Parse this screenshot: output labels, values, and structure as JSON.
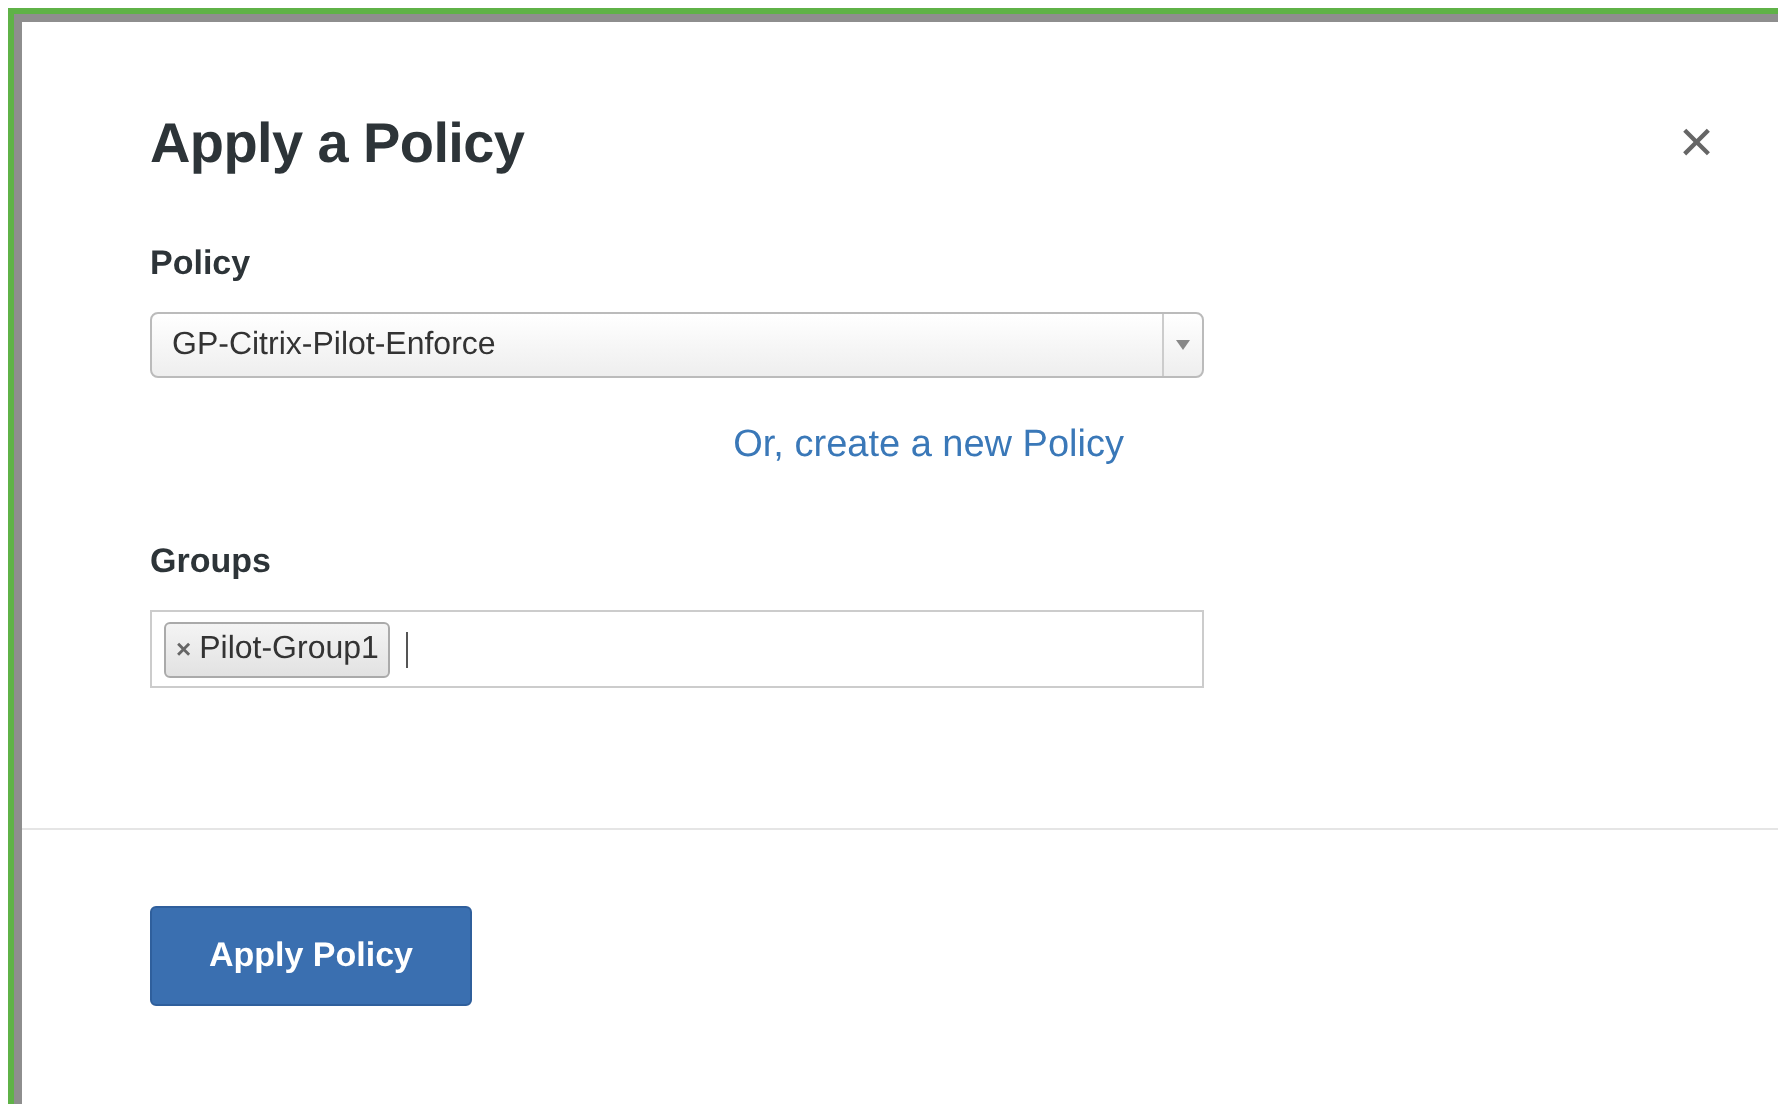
{
  "dialog": {
    "title": "Apply a Policy",
    "close": "×"
  },
  "policy": {
    "label": "Policy",
    "value": "GP-Citrix-Pilot-Enforce"
  },
  "create_link": "Or, create a new Policy",
  "groups": {
    "label": "Groups",
    "tags": [
      {
        "remove": "×",
        "label": "Pilot-Group1"
      }
    ]
  },
  "buttons": [
    "Apply Policy"
  ]
}
